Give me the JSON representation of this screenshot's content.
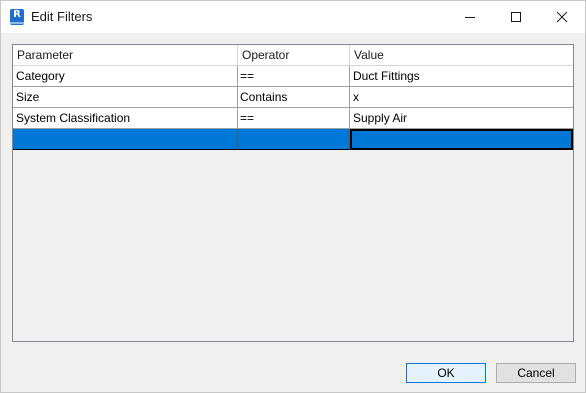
{
  "window": {
    "title": "Edit Filters",
    "app_icon_letter": "R",
    "icons": [
      "revit-app-icon",
      "minimize-icon",
      "maximize-icon",
      "close-icon"
    ]
  },
  "table": {
    "columns": [
      "Parameter",
      "Operator",
      "Value"
    ],
    "rows": [
      {
        "parameter": "Category",
        "operator": "==",
        "value": "Duct Fittings"
      },
      {
        "parameter": "Size",
        "operator": "Contains",
        "value": "x"
      },
      {
        "parameter": "System Classification",
        "operator": "==",
        "value": "Supply Air"
      }
    ],
    "selection_color": "#0078d7"
  },
  "buttons": {
    "ok_label": "OK",
    "cancel_label": "Cancel"
  }
}
